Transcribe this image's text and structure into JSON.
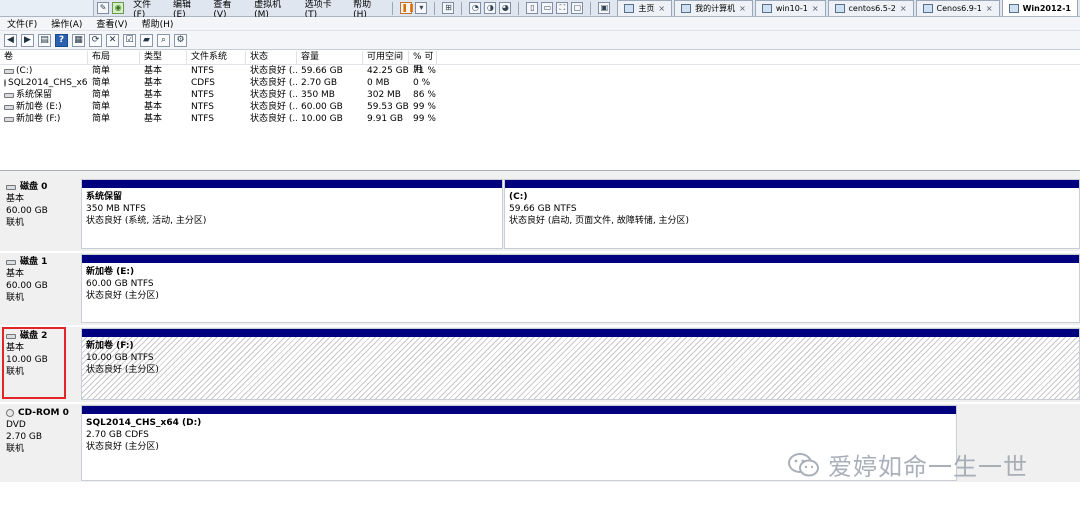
{
  "vm": {
    "menus": [
      "文件(F)",
      "编辑(E)",
      "查看(V)",
      "虚拟机(M)",
      "选项卡(T)",
      "帮助(H)"
    ],
    "tabs": [
      "主页",
      "我的计算机",
      "win10-1",
      "centos6.5-2",
      "Cenos6.9-1",
      "Win2012-1"
    ],
    "active_tab": "Win2012-1"
  },
  "app": {
    "menus": [
      "文件(F)",
      "操作(A)",
      "查看(V)",
      "帮助(H)"
    ]
  },
  "volumes": {
    "headers": [
      "卷",
      "布局",
      "类型",
      "文件系统",
      "状态",
      "容量",
      "可用空间",
      "% 可用"
    ],
    "rows": [
      {
        "name": "(C:)",
        "layout": "简单",
        "type": "基本",
        "fs": "NTFS",
        "status": "状态良好 (...",
        "cap": "59.66 GB",
        "free": "42.25 GB",
        "pct": "71 %",
        "icon": "disk"
      },
      {
        "name": "SQL2014_CHS_x6...",
        "layout": "简单",
        "type": "基本",
        "fs": "CDFS",
        "status": "状态良好 (...",
        "cap": "2.70 GB",
        "free": "0 MB",
        "pct": "0 %",
        "icon": "cd"
      },
      {
        "name": "系统保留",
        "layout": "简单",
        "type": "基本",
        "fs": "NTFS",
        "status": "状态良好 (...",
        "cap": "350 MB",
        "free": "302 MB",
        "pct": "86 %",
        "icon": "disk"
      },
      {
        "name": "新加卷 (E:)",
        "layout": "简单",
        "type": "基本",
        "fs": "NTFS",
        "status": "状态良好 (...",
        "cap": "60.00 GB",
        "free": "59.53 GB",
        "pct": "99 %",
        "icon": "disk"
      },
      {
        "name": "新加卷 (F:)",
        "layout": "简单",
        "type": "基本",
        "fs": "NTFS",
        "status": "状态良好 (...",
        "cap": "10.00 GB",
        "free": "9.91 GB",
        "pct": "99 %",
        "icon": "disk"
      }
    ]
  },
  "disks": [
    {
      "name": "磁盘 0",
      "type": "基本",
      "size": "60.00 GB",
      "state": "联机",
      "icon": "disk",
      "parts": [
        {
          "title": "系统保留",
          "info": "350 MB NTFS",
          "status": "状态良好 (系统, 活动, 主分区)"
        },
        {
          "title": "(C:)",
          "info": "59.66 GB NTFS",
          "status": "状态良好 (启动, 页面文件, 故障转储, 主分区)"
        }
      ]
    },
    {
      "name": "磁盘 1",
      "type": "基本",
      "size": "60.00 GB",
      "state": "联机",
      "icon": "disk",
      "parts": [
        {
          "title": "新加卷 (E:)",
          "info": "60.00 GB NTFS",
          "status": "状态良好 (主分区)"
        }
      ]
    },
    {
      "name": "磁盘 2",
      "type": "基本",
      "size": "10.00 GB",
      "state": "联机",
      "icon": "disk",
      "parts": [
        {
          "title": "新加卷 (F:)",
          "info": "10.00 GB NTFS",
          "status": "状态良好 (主分区)"
        }
      ]
    },
    {
      "name": "CD-ROM 0",
      "type": "DVD",
      "size": "2.70 GB",
      "state": "联机",
      "icon": "cd",
      "parts": [
        {
          "title": "SQL2014_CHS_x64 (D:)",
          "info": "2.70 GB CDFS",
          "status": "状态良好 (主分区)"
        }
      ]
    }
  ],
  "watermark": "爱婷如命一生一世",
  "colors": {
    "partition_bar": "#00007f",
    "highlight": "#e3252a"
  }
}
